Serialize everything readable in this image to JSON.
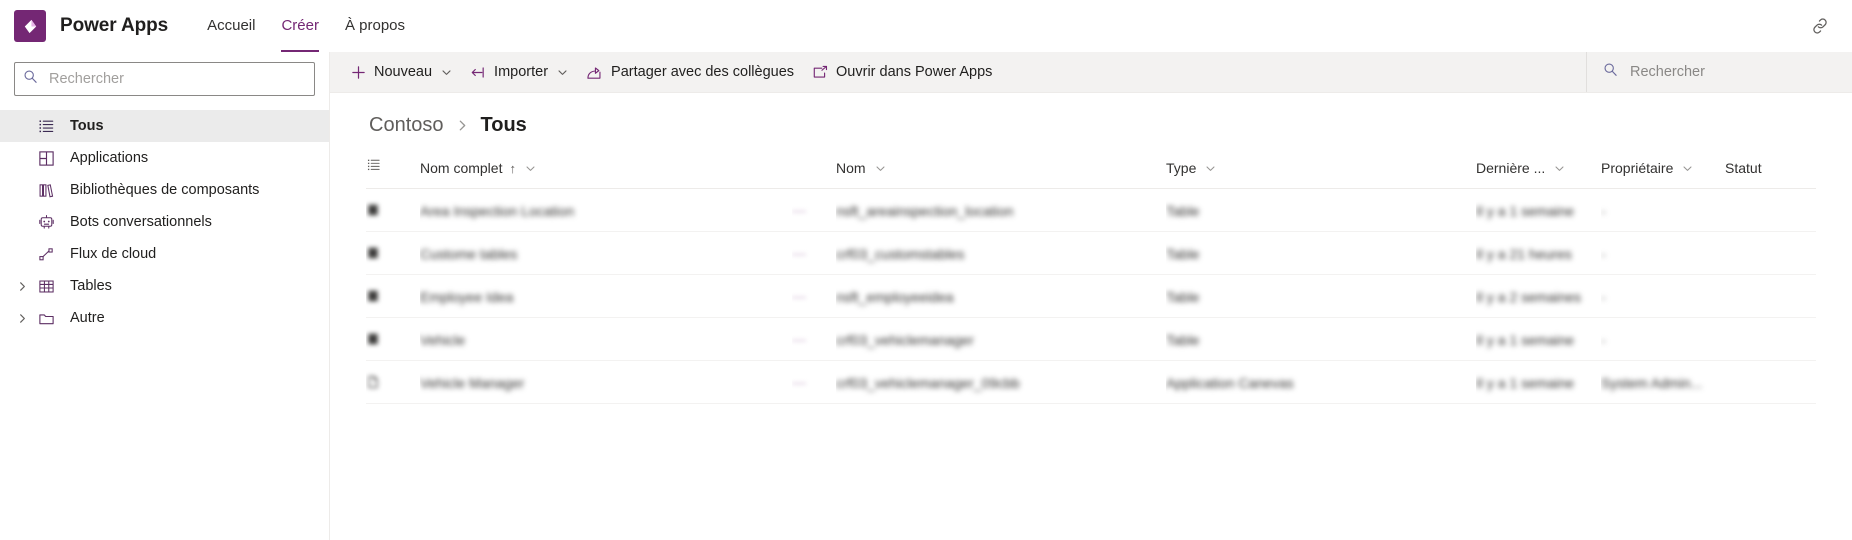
{
  "suitebar": {
    "logo_icon": "power-apps-logo-icon",
    "app_title": "Power Apps",
    "nav": [
      {
        "label": "Accueil",
        "active": false
      },
      {
        "label": "Créer",
        "active": true
      },
      {
        "label": "À propos",
        "active": false
      }
    ],
    "right_icons": [
      {
        "name": "link-icon",
        "glyph": "link"
      }
    ]
  },
  "sidebar": {
    "search": {
      "placeholder": "Rechercher",
      "value": "",
      "icon": "search-icon"
    },
    "items": [
      {
        "label": "Tous",
        "icon": "list-bullet-icon",
        "selected": true,
        "expandable": false
      },
      {
        "label": "Applications",
        "icon": "app-grid-icon",
        "selected": false,
        "expandable": false
      },
      {
        "label": "Bibliothèques de composants",
        "icon": "component-library-icon",
        "selected": false,
        "expandable": false
      },
      {
        "label": "Bots conversationnels",
        "icon": "chatbot-icon",
        "selected": false,
        "expandable": false
      },
      {
        "label": "Flux de cloud",
        "icon": "cloud-flow-icon",
        "selected": false,
        "expandable": false
      },
      {
        "label": "Tables",
        "icon": "table-icon",
        "selected": false,
        "expandable": true
      },
      {
        "label": "Autre",
        "icon": "folder-icon",
        "selected": false,
        "expandable": true
      }
    ]
  },
  "command_bar": {
    "buttons": [
      {
        "label": "Nouveau",
        "icon": "plus-icon",
        "has_caret": true
      },
      {
        "label": "Importer",
        "icon": "import-arrow-icon",
        "has_caret": true
      },
      {
        "label": "Partager avec des collègues",
        "icon": "share-icon",
        "has_caret": false
      },
      {
        "label": "Ouvrir dans Power Apps",
        "icon": "open-external-icon",
        "has_caret": false
      }
    ],
    "search": {
      "placeholder": "Rechercher",
      "value": "",
      "icon": "search-icon"
    }
  },
  "breadcrumb": {
    "root": "Contoso",
    "separator_icon": "chevron-right-icon",
    "current": "Tous"
  },
  "table": {
    "columns": [
      {
        "key": "icon",
        "label": "",
        "icon": "column-options-icon",
        "caret": false,
        "sorted": false
      },
      {
        "key": "name",
        "label": "Nom complet",
        "caret": true,
        "sorted": true,
        "sort_dir": "↑"
      },
      {
        "key": "dots",
        "label": "",
        "caret": false,
        "sorted": false
      },
      {
        "key": "nom",
        "label": "Nom",
        "caret": true,
        "sorted": false
      },
      {
        "key": "type",
        "label": "Type",
        "caret": true,
        "sorted": false
      },
      {
        "key": "last",
        "label": "Dernière ...",
        "caret": true,
        "sorted": false
      },
      {
        "key": "owner",
        "label": "Propriétaire",
        "caret": true,
        "sorted": false
      },
      {
        "key": "status",
        "label": "Statut",
        "caret": false,
        "sorted": false
      }
    ],
    "rows": [
      {
        "icon": "table-row-icon",
        "name": "Area Inspection Location",
        "dots": "—",
        "nom": "nsft_areainspection_location",
        "type": "Table",
        "last": "Il y a 1 semaine",
        "owner": "-",
        "status": ""
      },
      {
        "icon": "table-row-icon",
        "name": "Custome tables",
        "dots": "—",
        "nom": "crf03_customstables",
        "type": "Table",
        "last": "Il y a 21 heures",
        "owner": "-",
        "status": ""
      },
      {
        "icon": "table-row-icon",
        "name": "Employee Idea",
        "dots": "—",
        "nom": "nsft_employeeidea",
        "type": "Table",
        "last": "Il y a 2 semaines",
        "owner": "-",
        "status": ""
      },
      {
        "icon": "table-row-icon",
        "name": "Vehicle",
        "dots": "—",
        "nom": "crf03_vehiclemanager",
        "type": "Table",
        "last": "Il y a 1 semaine",
        "owner": "-",
        "status": ""
      },
      {
        "icon": "canvas-app-row-icon",
        "name": "Vehicle Manager",
        "dots": "—",
        "nom": "crf03_vehiclemanager_09cbb",
        "type": "Application Canevas",
        "last": "Il y a 1 semaine",
        "owner": "System Admin...",
        "status": ""
      }
    ]
  },
  "colors": {
    "brand": "#742774",
    "accent_icon": "#5c2e63",
    "selected_row_bg": "#ebebeb",
    "cmdbar_bg": "#f3f2f1"
  }
}
